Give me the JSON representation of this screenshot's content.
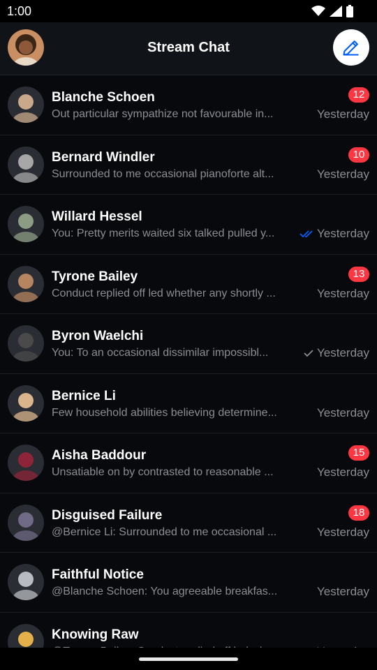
{
  "status_bar": {
    "time": "1:00"
  },
  "header": {
    "title": "Stream Chat",
    "avatar_icon": "user-avatar",
    "compose_icon": "pencil-icon",
    "accent": "#005fff"
  },
  "channels": [
    {
      "name": "Blanche Schoen",
      "preview": "Out particular sympathize not favourable in...",
      "time": "Yesterday",
      "unread": "12",
      "receipt": "none",
      "avatar_color": "#c9a98a"
    },
    {
      "name": "Bernard Windler",
      "preview": "Surrounded to me occasional pianoforte alt...",
      "time": "Yesterday",
      "unread": "10",
      "receipt": "none",
      "avatar_color": "#a7a7a7"
    },
    {
      "name": "Willard Hessel",
      "preview": "You: Pretty merits waited six talked pulled y...",
      "time": "Yesterday",
      "unread": "",
      "receipt": "read",
      "avatar_color": "#8c9c84"
    },
    {
      "name": "Tyrone Bailey",
      "preview": "Conduct replied off led whether any shortly ...",
      "time": "Yesterday",
      "unread": "13",
      "receipt": "none",
      "avatar_color": "#b58560"
    },
    {
      "name": "Byron Waelchi",
      "preview": "You: To an occasional dissimilar impossibl...",
      "time": "Yesterday",
      "unread": "",
      "receipt": "sent",
      "avatar_color": "#4a4a4a"
    },
    {
      "name": "Bernice Li",
      "preview": "Few household abilities believing determine...",
      "time": "Yesterday",
      "unread": "",
      "receipt": "none",
      "avatar_color": "#d9b48c"
    },
    {
      "name": "Aisha Baddour",
      "preview": "Unsatiable on by contrasted to reasonable ...",
      "time": "Yesterday",
      "unread": "15",
      "receipt": "none",
      "avatar_color": "#8e2438"
    },
    {
      "name": "Disguised Failure",
      "preview": "@Bernice Li: Surrounded to me occasional ...",
      "time": "Yesterday",
      "unread": "18",
      "receipt": "none",
      "avatar_color": "#6f6a86"
    },
    {
      "name": "Faithful Notice",
      "preview": "@Blanche Schoen: You agreeable breakfas...",
      "time": "Yesterday",
      "unread": "",
      "receipt": "none",
      "avatar_color": "#b8bcc2"
    },
    {
      "name": "Knowing Raw",
      "preview": "@Tyrone Bailey: Conduct replied off led wh...",
      "time": "Yesterday",
      "unread": "",
      "receipt": "none",
      "avatar_color": "#e4b04a"
    }
  ],
  "colors": {
    "badge": "#ff3742",
    "read_check": "#005fff",
    "secondary_text": "#8a8d93"
  }
}
